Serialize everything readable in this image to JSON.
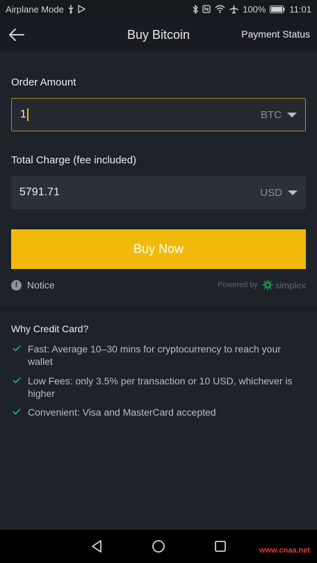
{
  "status_bar": {
    "left_text": "Airplane Mode",
    "battery": "100%",
    "time": "11:01"
  },
  "header": {
    "title": "Buy Bitcoin",
    "payment_status": "Payment Status"
  },
  "order": {
    "label": "Order Amount",
    "value": "1",
    "currency": "BTC"
  },
  "charge": {
    "label": "Total Charge (fee included)",
    "value": "5791.71",
    "currency": "USD"
  },
  "buy_button": "Buy Now",
  "notice": {
    "icon_glyph": "!",
    "label": "Notice"
  },
  "powered": {
    "text": "Powered by",
    "brand": "simplex"
  },
  "why": {
    "title": "Why Credit Card?",
    "items": [
      "Fast: Average 10–30 mins for cryptocurrency to reach your wallet",
      "Low Fees: only 3.5% per transaction or 10 USD, whichever is higher",
      "Convenient: Visa and MasterCard accepted"
    ]
  },
  "watermark": "www.cnaa.net",
  "colors": {
    "accent": "#f0b90b",
    "background": "#1e2329",
    "field": "#2b3139",
    "check": "#02c076"
  },
  "icons": {
    "status_left": [
      "usb-icon",
      "play-store-icon"
    ],
    "status_right": [
      "bluetooth-icon",
      "nfc-icon",
      "wifi-icon",
      "airplane-icon",
      "battery-icon"
    ],
    "nav": [
      "back-triangle-icon",
      "home-circle-icon",
      "recents-square-icon"
    ]
  }
}
